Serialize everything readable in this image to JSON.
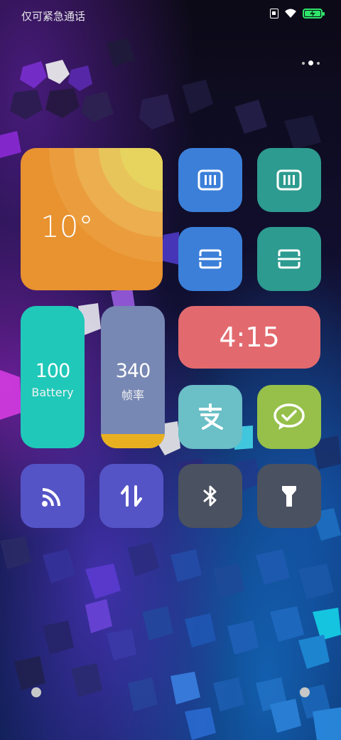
{
  "status_bar": {
    "carrier_text": "仅可紧急通话",
    "icons": [
      "sim-icon",
      "wifi-icon",
      "battery-charging-icon"
    ],
    "battery_color": "#2ee56a"
  },
  "page_indicator": {
    "count": 3,
    "active_index": 1
  },
  "widgets": {
    "weather": {
      "temperature": "10°",
      "color": "#e89230"
    },
    "toggles_row1": [
      {
        "icon": "barcode-scanner-icon",
        "color": "#3b7fd9"
      },
      {
        "icon": "barcode-scanner-icon",
        "color": "#2d9b8f"
      }
    ],
    "toggles_row2": [
      {
        "icon": "scan-frame-icon",
        "color": "#3b7fd9"
      },
      {
        "icon": "scan-frame-icon",
        "color": "#2d9b8f"
      }
    ],
    "battery": {
      "value": "100",
      "label": "Battery",
      "color": "#20c8b9"
    },
    "fps": {
      "value": "340",
      "label": "帧率",
      "color": "#7788b4",
      "bar_color": "#e8b020"
    },
    "clock": {
      "time": "4:15",
      "color": "#e26a6e"
    },
    "apps": [
      {
        "icon": "alipay-icon",
        "color": "#6bbfc6"
      },
      {
        "icon": "wechat-icon",
        "color": "#96c04a"
      }
    ],
    "quick_toggles": [
      {
        "icon": "cast-icon",
        "color": "#5554c6"
      },
      {
        "icon": "mobile-data-icon",
        "color": "#5554c6"
      },
      {
        "icon": "bluetooth-icon",
        "color": "#4a5160"
      },
      {
        "icon": "flashlight-icon",
        "color": "#4a5160"
      }
    ]
  }
}
